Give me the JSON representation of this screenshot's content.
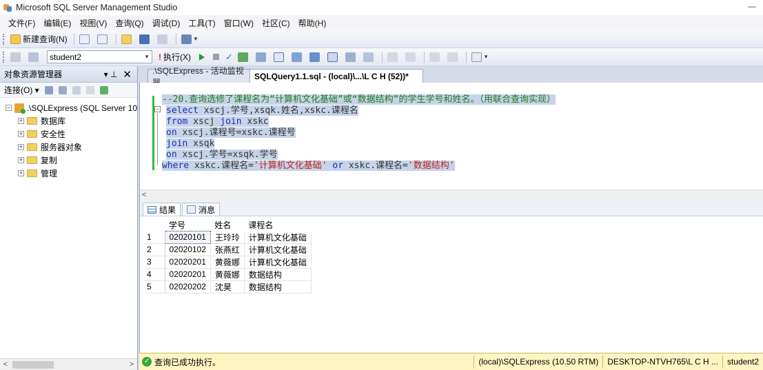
{
  "window": {
    "title": "Microsoft SQL Server Management Studio",
    "minimize": "—"
  },
  "menu": [
    "文件(F)",
    "编辑(E)",
    "视图(V)",
    "查询(Q)",
    "调试(D)",
    "工具(T)",
    "窗口(W)",
    "社区(C)",
    "帮助(H)"
  ],
  "toolbar1": {
    "new_query": "新建查询(N)"
  },
  "toolbar2": {
    "database": "student2",
    "execute": "执行(X)"
  },
  "explorer": {
    "title": "对象资源管理器",
    "pin": "▾ ⊥",
    "close": "✕",
    "connect": "连接(O) ▾",
    "server": ".\\SQLExpress (SQL Server 10",
    "folders": [
      "数据库",
      "安全性",
      "服务器对象",
      "复制",
      "管理"
    ]
  },
  "tabs": {
    "monitor": ".\\SQLExpress - 活动监视器",
    "query": "SQLQuery1.1.sql - (local)\\...\\L C H (52))*"
  },
  "editor": {
    "comment": "--20.查询选修了课程名为“计算机文化基础”或“数据结构”的学生学号和姓名。（用联合查询实现）",
    "line1_kw": "select",
    "line1_rest": " xscj.学号,xsqk.姓名,xskc.课程名",
    "line2_kw1": "from",
    "line2_mid": " xscj ",
    "line2_kw2": "join",
    "line2_rest": " xskc",
    "line3_kw": "on",
    "line3_rest": " xscj.课程号=xskc.课程号",
    "line4_kw": "join",
    "line4_rest": " xsqk",
    "line5_kw": "on",
    "line5_rest": " xscj.学号=xsqk.学号",
    "line6_kw": "where",
    "line6_a": " xskc.课程名=",
    "line6_str1": "'计算机文化基础'",
    "line6_or": " or ",
    "line6_b": "xskc.课程名=",
    "line6_str2": "'数据结构'"
  },
  "results": {
    "tab_results": "结果",
    "tab_messages": "消息",
    "columns": [
      "学号",
      "姓名",
      "课程名"
    ],
    "rows": [
      [
        "1",
        "02020101",
        "王玲玲",
        "计算机文化基础"
      ],
      [
        "2",
        "02020102",
        "张燕红",
        "计算机文化基础"
      ],
      [
        "3",
        "02020201",
        "黄薇娜",
        "计算机文化基础"
      ],
      [
        "4",
        "02020201",
        "黄薇娜",
        "数据结构"
      ],
      [
        "5",
        "02020202",
        "沈昊",
        "数据结构"
      ]
    ]
  },
  "status": {
    "message": "查询已成功执行。",
    "server": "(local)\\SQLExpress (10.50 RTM)",
    "host": "DESKTOP-NTVH765\\L C H ...",
    "db": "student2"
  }
}
